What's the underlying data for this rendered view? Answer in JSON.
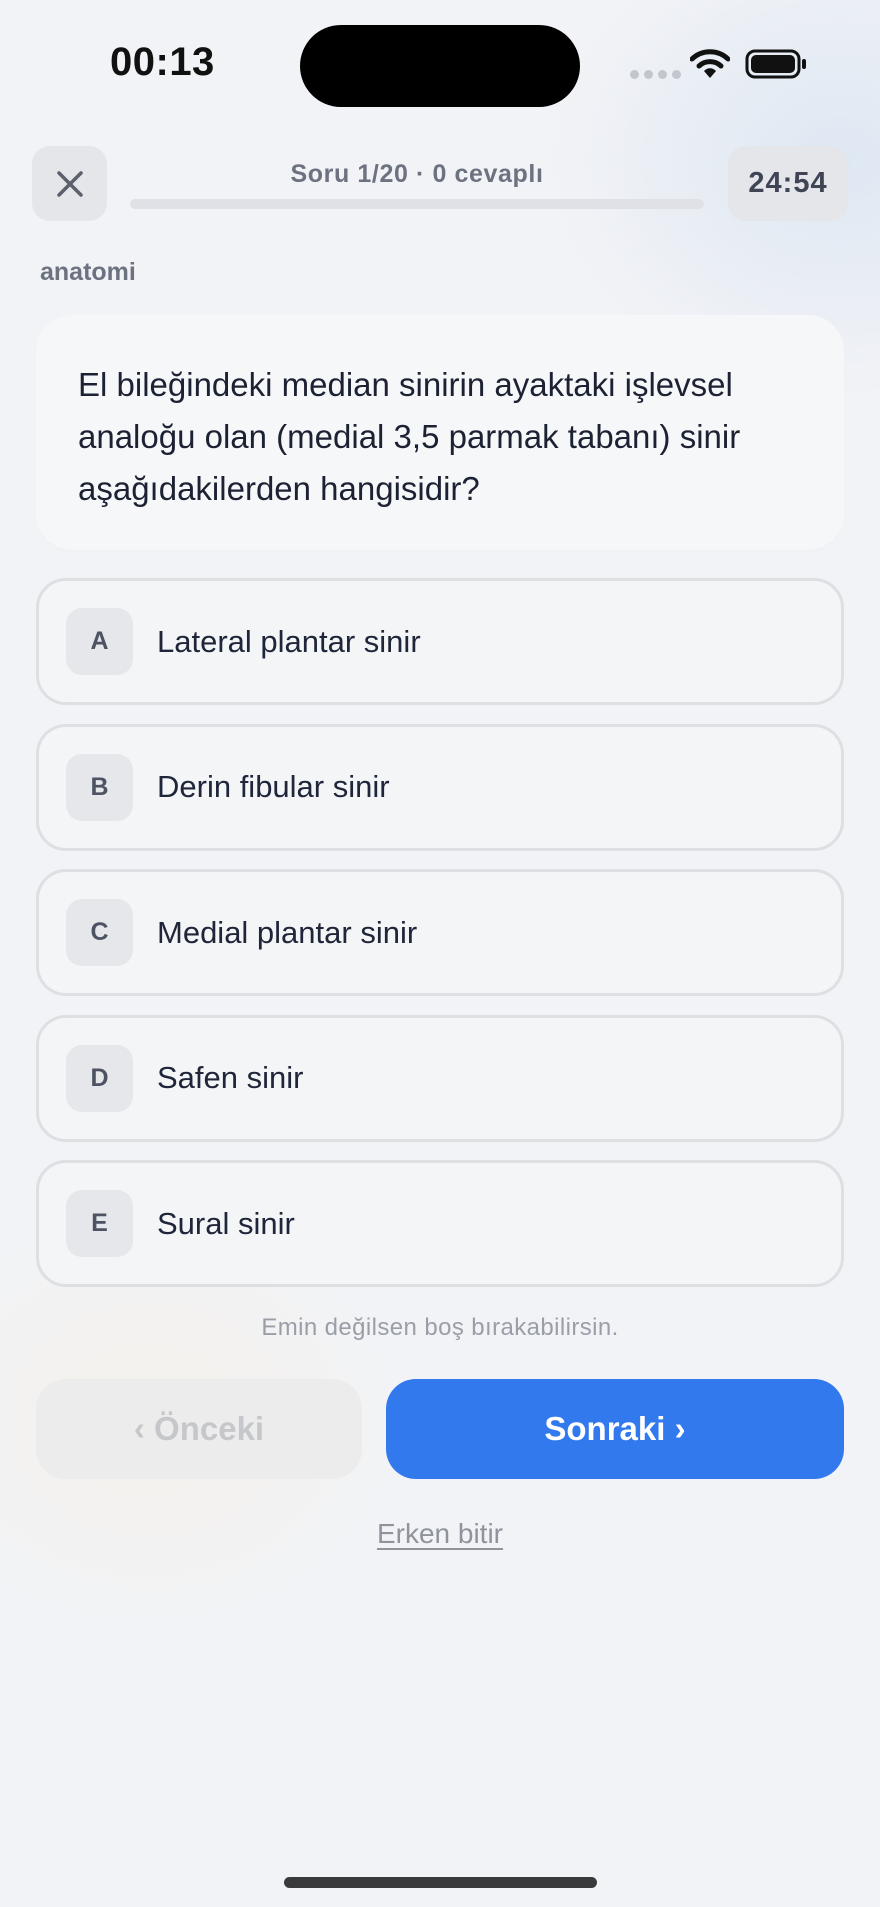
{
  "status_bar": {
    "time": "00:13",
    "icons": [
      "signal-icon",
      "wifi-icon",
      "battery-icon"
    ]
  },
  "header": {
    "close_icon": "close-icon",
    "progress_label": "Soru 1/20 · 0 cevaplı",
    "progress_fraction": 0,
    "timer": "24:54"
  },
  "topic": "anatomi",
  "question": {
    "text": "El bileğindeki median sinirin ayaktaki işlevsel analoğu olan (medial 3,5 parmak tabanı) sinir aşağıdakilerden hangisidir?"
  },
  "options": [
    {
      "letter": "A",
      "text": "Lateral plantar sinir"
    },
    {
      "letter": "B",
      "text": "Derin fibular sinir"
    },
    {
      "letter": "C",
      "text": "Medial plantar sinir"
    },
    {
      "letter": "D",
      "text": "Safen sinir"
    },
    {
      "letter": "E",
      "text": "Sural sinir"
    }
  ],
  "hint": "Emin değilsen boş bırakabilirsin.",
  "nav": {
    "prev_label": "‹ Önceki",
    "next_label": "Sonraki ›",
    "finish_label": "Erken bitir"
  },
  "colors": {
    "accent": "#3279ee",
    "background": "#f2f3f6"
  }
}
